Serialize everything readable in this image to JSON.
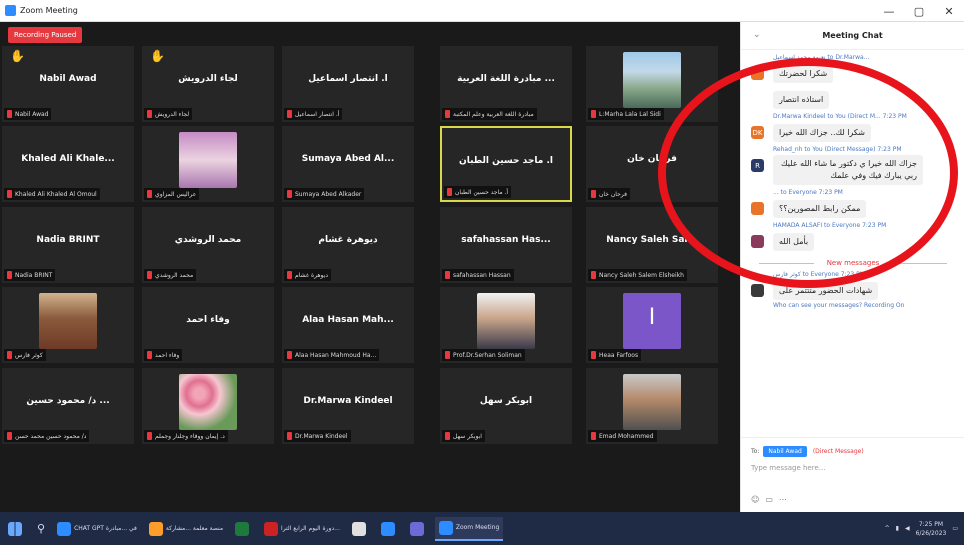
{
  "window": {
    "title": "Zoom Meeting",
    "controls": [
      "—",
      "▢",
      "✕"
    ]
  },
  "recording": "Recording Paused",
  "tiles": [
    {
      "name": "Nabil Awad",
      "label": "Nabil Awad",
      "hand": true
    },
    {
      "name": "لجاء الدرويش",
      "label": "لجاء الدرويش",
      "hand": true
    },
    {
      "name": "أ. انتصار اسماعيل",
      "label": "أ. انتصار اسماعيل"
    },
    {
      "name": "مبادرة اللغة العربية ...",
      "label": "مبادرة اللغة العربية وعلم المكتبة"
    },
    {
      "name": "",
      "label": "L:Marha Lala Lal Sidi",
      "avatar": "av-flag"
    },
    {
      "name": "Khaled Ali Khale...",
      "label": "Khaled Ali Khaled Al Omoul"
    },
    {
      "name": "",
      "label": "عراليس المزاوي",
      "avatar": "av-hijab"
    },
    {
      "name": "Sumaya Abed Al...",
      "label": "Sumaya Abed Alkader"
    },
    {
      "name": "أ. ماجد حسين الطبان",
      "label": "أ. ماجد حسين الطبان",
      "highlight": true
    },
    {
      "name": "فرحان خان",
      "label": "فرحان خان"
    },
    {
      "name": "Nadia BRINT",
      "label": "Nadia BRINT"
    },
    {
      "name": "محمد الروشدي",
      "label": "محمد الروشدي"
    },
    {
      "name": "ديوهرة غشام",
      "label": "ديوهرة غشام"
    },
    {
      "name": "safahassan Has...",
      "label": "safahassan Hassan"
    },
    {
      "name": "Nancy Saleh Sal...",
      "label": "Nancy Saleh Salem Elsheikh"
    },
    {
      "name": "",
      "label": "كوثر فارس",
      "avatar": "av-woman"
    },
    {
      "name": "وفاء احمد",
      "label": "وفاء احمد"
    },
    {
      "name": "Alaa Hasan Mah...",
      "label": "Alaa Hasan Mahmoud Ha..."
    },
    {
      "name": "",
      "label": "Prof.Dr.Serhan Soliman",
      "avatar": "av-man"
    },
    {
      "name": "",
      "label": "Heaa Farfoos",
      "avatar": "av-purple"
    },
    {
      "name": "د/ محمود حسين ...",
      "label": "د/ محمود حسين محمد حسن"
    },
    {
      "name": "",
      "label": "د. إيمان ووفاء وجلنار وجملم",
      "avatar": "av-flower"
    },
    {
      "name": "Dr.Marwa Kindeel",
      "label": "Dr.Marwa Kindeel"
    },
    {
      "name": "ابوبكر سهل",
      "label": "ابوبكر سهل"
    },
    {
      "name": "",
      "label": "Emad Mohammed",
      "avatar": "av-oldman"
    }
  ],
  "chat": {
    "title": "Meeting Chat",
    "messages": [
      {
        "from": "نعيمة محمد اسماعيل to Dr.Marwa...",
        "text": "شكرا لحضرتك",
        "color": "#e8742a",
        "initial": ""
      },
      {
        "from": "",
        "text": "استاذه انتصار",
        "color": "",
        "initial": ""
      },
      {
        "from": "Dr.Marwa Kindeel to You (Direct M... 7:23 PM",
        "text": "شكرا لك.. جزاك الله خيرا",
        "color": "#e8742a",
        "initial": "DK"
      },
      {
        "from": "Rehad_nh to You (Direct Message) 7:23 PM",
        "text": "جزاك الله خيرا ي دكتور ما شاء الله عليك ربي يبارك فيك وفي علمك",
        "color": "#2b3a67",
        "initial": "R"
      },
      {
        "from": "... to Everyone 7:23 PM",
        "text": "ممكن رابط المصورين؟؟",
        "color": "#e8742a",
        "initial": ""
      },
      {
        "from": "HAMADA ALSAFI to Everyone 7:23 PM",
        "text": "بأمل الله",
        "color": "#8a3a5a",
        "initial": ""
      }
    ],
    "new_messages": "New messages",
    "after": [
      {
        "from": "كوثر فارس to Everyone 7:23 PM",
        "text": "شهادات الحضور متتتمر على",
        "color": "#3a3a3a",
        "initial": ""
      }
    ],
    "notice": "Who can see your messages? Recording On",
    "to_label": "To:",
    "to_chip": "Nabil Awad",
    "direct": "(Direct Message)",
    "placeholder": "Type message here..."
  },
  "taskbar": {
    "items": [
      {
        "label": "CHAT GPT في ...مبادرة",
        "color": "#2d8cff",
        "active": false
      },
      {
        "label": "منصة معلمة ...مشاركة",
        "color": "#ff9d2a",
        "active": false
      },
      {
        "label": "",
        "color": "#1e7a3c",
        "active": false
      },
      {
        "label": "دورة اليوم الرابع الترا...",
        "color": "#c22",
        "active": false
      },
      {
        "label": "",
        "color": "#e0e0e0",
        "active": false
      },
      {
        "label": "",
        "color": "#2d8cff",
        "active": false
      },
      {
        "label": "",
        "color": "#6b6bd8",
        "active": false
      },
      {
        "label": "Zoom Meeting",
        "color": "#2d8cff",
        "active": true
      }
    ],
    "time": "7:25 PM",
    "date": "6/26/2023"
  }
}
